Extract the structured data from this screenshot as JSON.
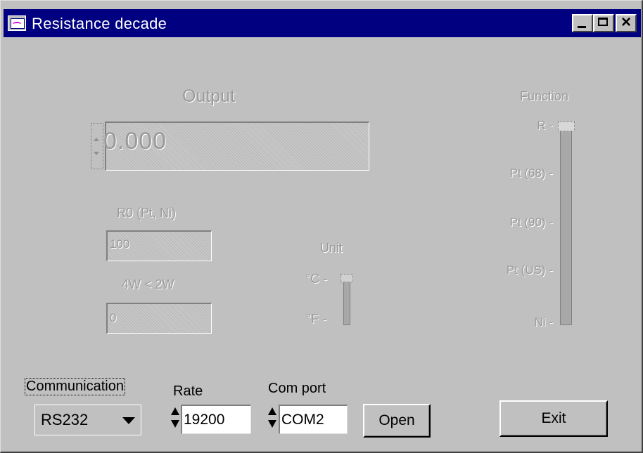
{
  "window": {
    "title": "Resistance decade",
    "controls": [
      "minimize",
      "maximize",
      "close"
    ],
    "close_glyph": "×"
  },
  "output": {
    "label": "Output",
    "value": "0.000"
  },
  "r0": {
    "label": "R0 (Pt, Ni)",
    "value": "100"
  },
  "wire_mode": {
    "label": "4W < 2W",
    "value": "0"
  },
  "unit": {
    "label": "Unit",
    "options": [
      "°C",
      "°F"
    ],
    "selected": "°C"
  },
  "function": {
    "label": "Function",
    "options": [
      "R",
      "Pt (68)",
      "Pt (90)",
      "Pt (US)",
      "Ni"
    ],
    "selected": "R"
  },
  "communication": {
    "label": "Communication",
    "selected": "RS232"
  },
  "rate": {
    "label": "Rate",
    "value": "19200"
  },
  "com_port": {
    "label": "Com port",
    "value": "COM2"
  },
  "buttons": {
    "open": "Open",
    "exit": "Exit"
  },
  "colors": {
    "titlebar": "#000080",
    "face": "#c0c0c0",
    "disabled_text": "#9a9a9a"
  }
}
